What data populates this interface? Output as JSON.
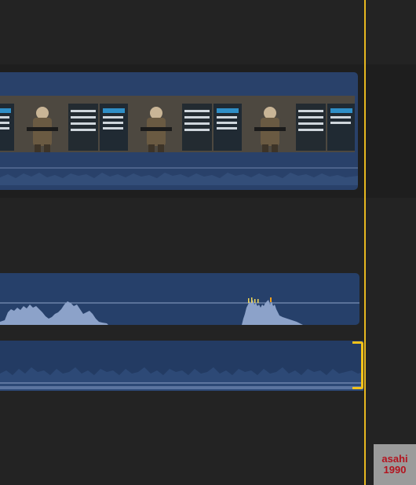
{
  "timeline": {
    "video_clip": {
      "frames": 4
    },
    "audio_clips": 2
  },
  "watermark": {
    "line1": "asahi",
    "line2": "1990"
  },
  "colors": {
    "background": "#232323",
    "clip_blue": "#29416a",
    "playhead": "#e8b81f",
    "trim_handle": "#f2c21a",
    "waveform": "#7e94bd"
  }
}
